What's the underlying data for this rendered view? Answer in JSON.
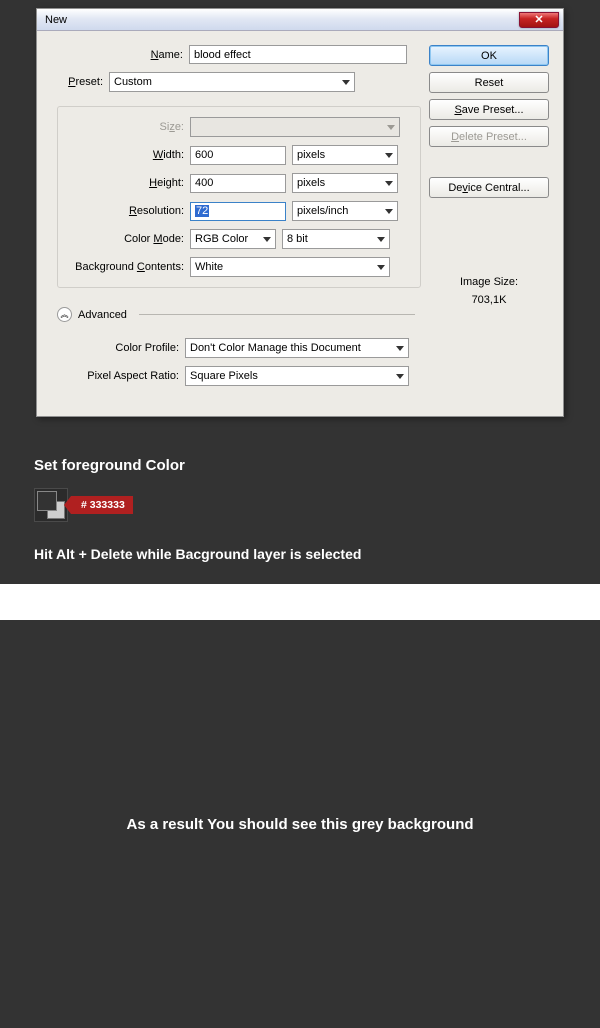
{
  "dialog": {
    "title": "New",
    "labels": {
      "name": "Name:",
      "preset": "Preset:",
      "size": "Size:",
      "width": "Width:",
      "height": "Height:",
      "resolution": "Resolution:",
      "color_mode": "Color Mode:",
      "bg_contents": "Background Contents:",
      "advanced": "Advanced",
      "color_profile": "Color Profile:",
      "pixel_ratio": "Pixel Aspect Ratio:"
    },
    "underline": {
      "name": "N",
      "preset": "P",
      "size": "z",
      "width": "W",
      "height": "H",
      "resolution": "R",
      "color_mode": "M",
      "bg_contents": "C",
      "color_profile": "",
      "pixel_ratio": ""
    },
    "values": {
      "name": "blood effect",
      "preset": "Custom",
      "size": "",
      "width": "600",
      "height": "400",
      "resolution": "72",
      "width_unit": "pixels",
      "height_unit": "pixels",
      "resolution_unit": "pixels/inch",
      "color_mode": "RGB Color",
      "bit_depth": "8 bit",
      "bg_contents": "White",
      "color_profile": "Don't Color Manage this Document",
      "pixel_ratio": "Square Pixels"
    },
    "buttons": {
      "ok": "OK",
      "reset": "Reset",
      "save_preset": "Save Preset...",
      "delete_preset": "Delete Preset...",
      "device_central": "Device Central..."
    },
    "button_underline": {
      "save_preset": "S",
      "delete_preset": "D",
      "device_central": "v"
    },
    "image_size": {
      "label": "Image Size:",
      "value": "703,1K"
    },
    "close_glyph": "✕"
  },
  "step": {
    "set_fg": "Set foreground Color",
    "hex": "# 333333",
    "tip": "Hit Alt + Delete while Bacground layer is selected"
  },
  "result": {
    "text": "As a result You should see this grey background"
  }
}
